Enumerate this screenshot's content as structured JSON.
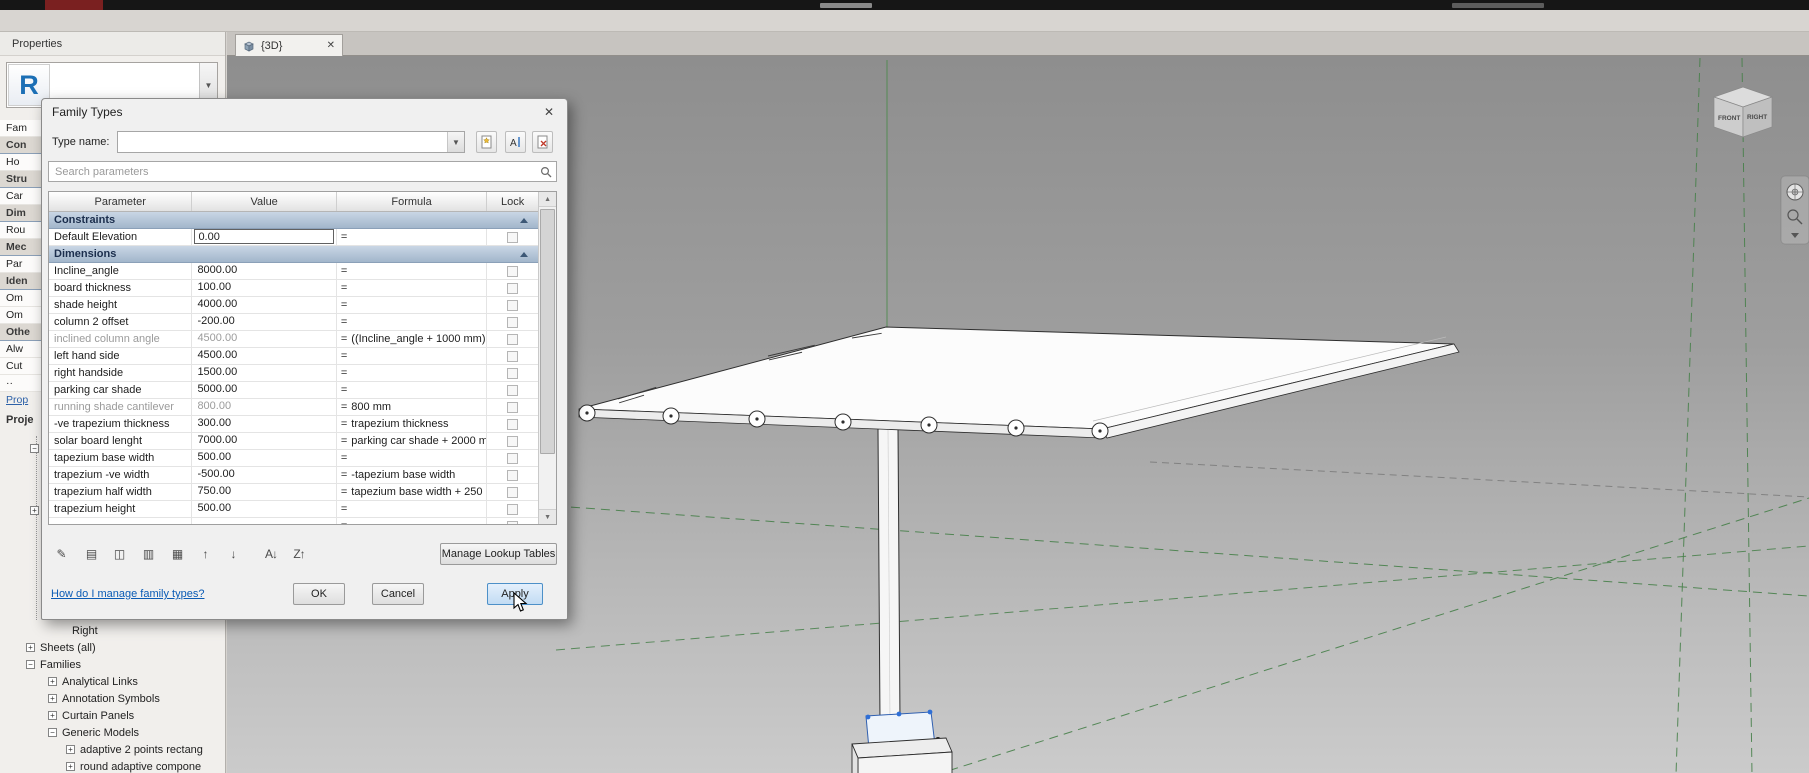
{
  "titlebar": {
    "accent_color": "#7a2020"
  },
  "left_panel": {
    "title": "Properties",
    "type_selector": {
      "letter": "R"
    },
    "rows": [
      {
        "type": "item",
        "label": "Fam"
      },
      {
        "type": "group",
        "label": "Con"
      },
      {
        "type": "item",
        "label": "Ho"
      },
      {
        "type": "group",
        "label": "Stru"
      },
      {
        "type": "item",
        "label": "Car"
      },
      {
        "type": "group",
        "label": "Dim"
      },
      {
        "type": "item",
        "label": "Rou"
      },
      {
        "type": "group",
        "label": "Mec"
      },
      {
        "type": "item",
        "label": "Par"
      },
      {
        "type": "group",
        "label": "Iden"
      },
      {
        "type": "item",
        "label": "Om"
      },
      {
        "type": "item",
        "label": "Om"
      },
      {
        "type": "group",
        "label": "Othe"
      },
      {
        "type": "item",
        "label": "Alw"
      },
      {
        "type": "item",
        "label": "Cut"
      },
      {
        "type": "item",
        "label": "··"
      },
      {
        "type": "link",
        "label": "Prop"
      }
    ],
    "project_browser_title": "Proje",
    "tree_items": [
      {
        "label": "Right",
        "indent": 58,
        "exp": ""
      },
      {
        "label": "Sheets (all)",
        "indent": 26,
        "exp": "+"
      },
      {
        "label": "Families",
        "indent": 26,
        "exp": "−"
      },
      {
        "label": "Analytical Links",
        "indent": 48,
        "exp": "+"
      },
      {
        "label": "Annotation Symbols",
        "indent": 48,
        "exp": "+"
      },
      {
        "label": "Curtain Panels",
        "indent": 48,
        "exp": "+"
      },
      {
        "label": "Generic Models",
        "indent": 48,
        "exp": "−"
      },
      {
        "label": "adaptive 2 points rectang",
        "indent": 66,
        "exp": "+"
      },
      {
        "label": "round adaptive compone",
        "indent": 66,
        "exp": "+"
      }
    ]
  },
  "tab": {
    "label": "{3D}"
  },
  "dialog": {
    "title": "Family Types",
    "type_name_label": "Type name:",
    "search_placeholder": "Search parameters",
    "columns": {
      "parameter": "Parameter",
      "value": "Value",
      "formula": "Formula",
      "lock": "Lock"
    },
    "rows": [
      {
        "type": "group",
        "label": "Constraints"
      },
      {
        "type": "param",
        "param": "Default Elevation",
        "value": "0.00",
        "formula": "",
        "editing": true
      },
      {
        "type": "group",
        "label": "Dimensions"
      },
      {
        "type": "param",
        "param": "Incline_angle",
        "value": "8000.00",
        "formula": ""
      },
      {
        "type": "param",
        "param": "board thickness",
        "value": "100.00",
        "formula": ""
      },
      {
        "type": "param",
        "param": "shade height",
        "value": "4000.00",
        "formula": ""
      },
      {
        "type": "param",
        "param": "column 2 offset",
        "value": "-200.00",
        "formula": ""
      },
      {
        "type": "param",
        "param": "inclined column angle",
        "value": "4500.00",
        "formula": "((Incline_angle + 1000 mm)",
        "gray": true
      },
      {
        "type": "param",
        "param": "left hand side",
        "value": "4500.00",
        "formula": ""
      },
      {
        "type": "param",
        "param": "right handside",
        "value": "1500.00",
        "formula": ""
      },
      {
        "type": "param",
        "param": "parking car shade",
        "value": "5000.00",
        "formula": ""
      },
      {
        "type": "param",
        "param": "running shade cantilever",
        "value": "800.00",
        "formula": "800 mm",
        "gray": true
      },
      {
        "type": "param",
        "param": "-ve trapezium thickness",
        "value": "300.00",
        "formula": "trapezium thickness"
      },
      {
        "type": "param",
        "param": "solar board lenght",
        "value": "7000.00",
        "formula": "parking car shade + 2000 m"
      },
      {
        "type": "param",
        "param": "tapezium base width",
        "value": "500.00",
        "formula": ""
      },
      {
        "type": "param",
        "param": "trapezium -ve width",
        "value": "-500.00",
        "formula": "-tapezium base width"
      },
      {
        "type": "param",
        "param": "trapezium half width",
        "value": "750.00",
        "formula": "tapezium base width + 250"
      },
      {
        "type": "param",
        "param": "trapezium height",
        "value": "500.00",
        "formula": ""
      },
      {
        "type": "param",
        "param": "",
        "value": "",
        "formula": ""
      }
    ],
    "toolbar_icons": [
      {
        "glyph": "✎",
        "name": "edit-parameter-icon"
      },
      {
        "glyph": "▤",
        "name": "new-parameter-icon"
      },
      {
        "glyph": "◫",
        "name": "duplicate-parameter-icon"
      },
      {
        "glyph": "▥",
        "name": "delete-parameter-icon"
      },
      {
        "glyph": "▦",
        "name": "copy-parameter-icon"
      },
      {
        "glyph": "↑",
        "name": "move-parameter-up-icon"
      },
      {
        "glyph": "↓",
        "name": "move-parameter-down-icon"
      },
      {
        "glyph": "A↓",
        "name": "sort-ascending-icon"
      },
      {
        "glyph": "Z↑",
        "name": "sort-descending-icon"
      }
    ],
    "manage_lookup_label": "Manage Lookup Tables",
    "help_link": "How do I manage family types?",
    "ok_label": "OK",
    "cancel_label": "Cancel",
    "apply_label": "Apply"
  },
  "viewport": {
    "viewcube": {
      "front": "FRONT",
      "right": "RIGHT"
    }
  }
}
